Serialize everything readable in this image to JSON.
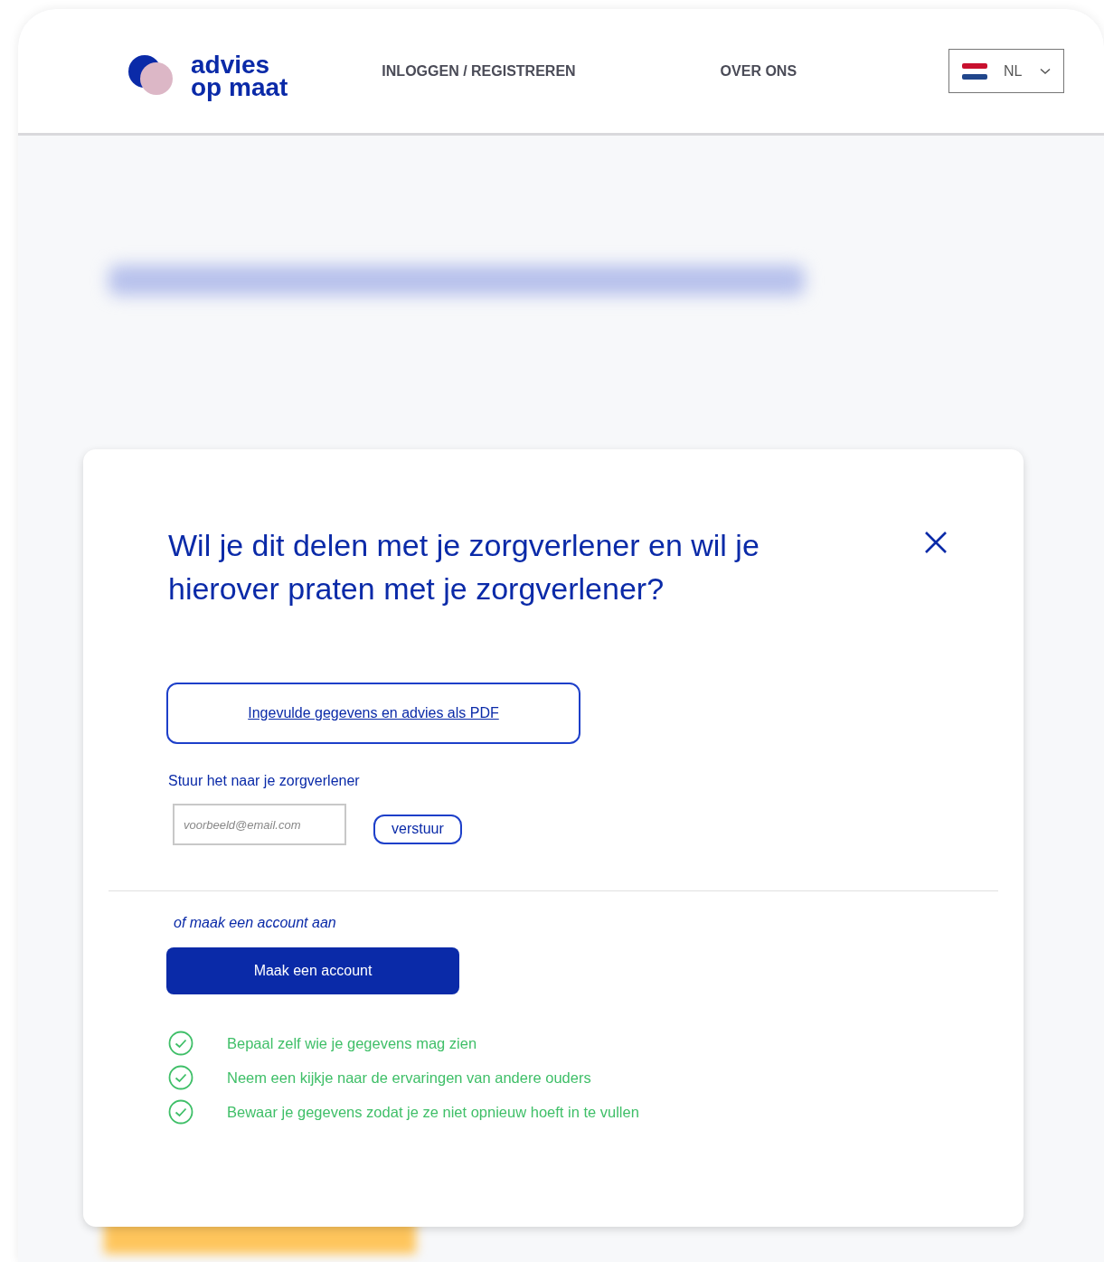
{
  "header": {
    "logo": {
      "line1": "advies",
      "line2": "op maat"
    },
    "nav": [
      "INLOGGEN / REGISTREREN",
      "OVER ONS"
    ],
    "language": {
      "code": "NL"
    }
  },
  "dialog": {
    "title": "Wil je dit delen met je zorgverlener en wil je hierover praten met je zorgverlener?",
    "pdf_link": "Ingevulde gegevens en advies als PDF",
    "send_label": "Stuur het naar je zorgverlener",
    "email": {
      "placeholder": "voorbeeld@email.com"
    },
    "send_button": "verstuur",
    "account_hint": "of maak een account aan",
    "account_button": "Maak een account",
    "benefits": [
      {
        "text": "Bepaal zelf wie je gegevens mag zien",
        "checked": true
      },
      {
        "text": "Neem een kijkje naar de ervaringen van andere ouders",
        "checked": true
      },
      {
        "text": "Bewaar je gegevens zodat je ze niet opnieuw hoeft in te vullen",
        "checked": true
      }
    ]
  }
}
